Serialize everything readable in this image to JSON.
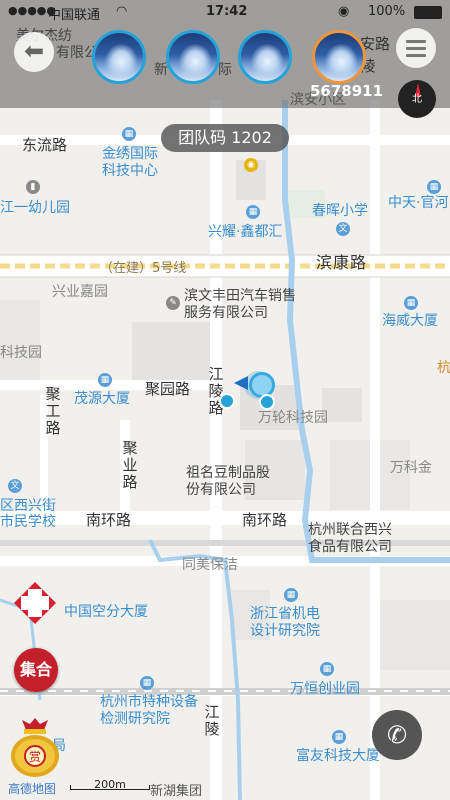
{
  "status_bar": {
    "carrier": "中国联通",
    "time": "17:42",
    "battery": "100%"
  },
  "header": {
    "phone_partial": "5678911"
  },
  "team_code": "团队码 1202",
  "compass_label": "北",
  "gather_label": "集合",
  "map": {
    "roads": {
      "binkang": "滨康路",
      "line5": "（在建）5号线",
      "dongliu": "东流路",
      "juyuan": "聚园路",
      "nanhuan_left": "南环路",
      "nanhuan_right": "南环路",
      "jiangling_1": "江陵路",
      "jiangling_2": "江陵",
      "jugong": "聚工路",
      "juye": "聚业路"
    },
    "pois": {
      "jinxiu": "金绣国际科技中心",
      "xingyao": "兴耀·鑫都汇",
      "chunhui": "春晖小学",
      "zhongtian": "中天·官河",
      "xingye": "兴业嘉园",
      "binwen": "滨文丰田汽车销售服务有限公司",
      "haiwei": "海威大厦",
      "kejiyuan": "科技园",
      "maoyuan": "茂源大厦",
      "wanlun": "万轮科技园",
      "wanke": "万科金",
      "zuming": "祖名豆制品股份有限公司",
      "xixing": "区西兴街",
      "shiminxue": "市民学校",
      "hzlianhe": "杭州联合西兴食品有限公司",
      "tongmei": "同美保洁",
      "zhongguo": "中国空分大厦",
      "zhejiang": "浙江省机电设计研究院",
      "wanheng": "万恒创业园",
      "tezhong": "杭州市特种设备检测研究院",
      "fuyou": "富友科技大厦",
      "yiyou": "江一幼儿园",
      "ju": "局",
      "xinhu": "新湖集团",
      "binan": "滨安路",
      "binanxq": "滨安小区",
      "xinsheng": "新",
      "shengji": "际",
      "lingzi": "陵",
      "meierjie": "美尔杰纺",
      "youxian": "有限公",
      "hang": "杭"
    }
  },
  "footer": {
    "amap_logo": "高德地图",
    "scale": "200m"
  },
  "icons": {
    "back": "back-arrow-icon",
    "menu": "menu-icon",
    "compass": "compass-icon",
    "first_aid": "first-aid-icon",
    "money_bag": "money-bag-icon",
    "phone": "phone-icon",
    "location": "location-arrow-icon"
  },
  "colors": {
    "avatar_border": "#25a3d9",
    "avatar_selected_border": "#f0953a",
    "gather_red": "#c4202c",
    "location_blue": "#1e9bd7"
  }
}
